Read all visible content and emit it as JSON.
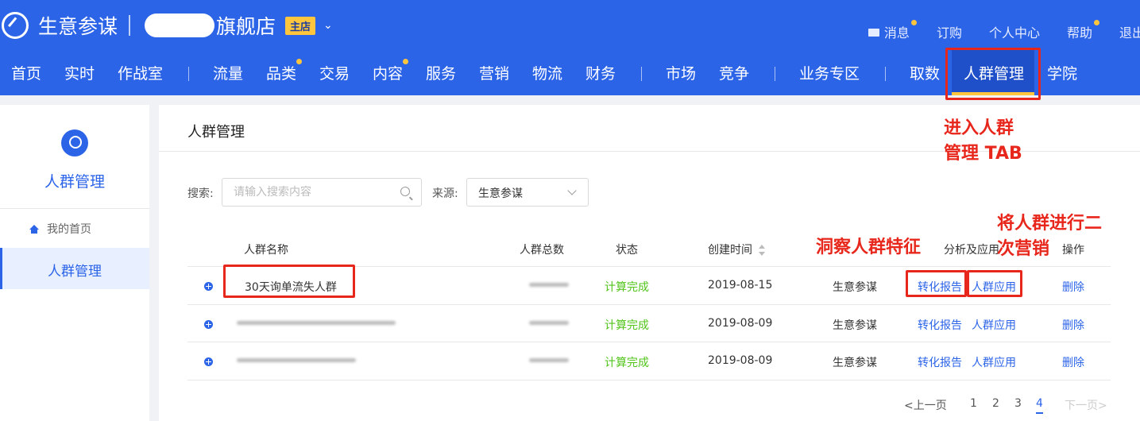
{
  "brand": {
    "name": "生意参谋",
    "shop_suffix": "旗舰店",
    "badge": "主店"
  },
  "top_links": [
    {
      "label": "消息",
      "dot": true
    },
    {
      "label": "订购",
      "dot": false
    },
    {
      "label": "个人中心",
      "dot": false
    },
    {
      "label": "帮助",
      "dot": true
    },
    {
      "label": "退出",
      "dot": false
    }
  ],
  "nav": [
    {
      "label": "首页"
    },
    {
      "label": "实时"
    },
    {
      "label": "作战室"
    },
    {
      "label": "流量"
    },
    {
      "label": "品类",
      "dot": true
    },
    {
      "label": "交易"
    },
    {
      "label": "内容",
      "dot": true
    },
    {
      "label": "服务"
    },
    {
      "label": "营销"
    },
    {
      "label": "物流"
    },
    {
      "label": "财务"
    },
    {
      "label": "市场"
    },
    {
      "label": "竞争"
    },
    {
      "label": "业务专区"
    },
    {
      "label": "取数"
    },
    {
      "label": "人群管理",
      "active": true
    },
    {
      "label": "学院"
    }
  ],
  "sidebar": {
    "title": "人群管理",
    "home": "我的首页",
    "active_item": "人群管理"
  },
  "panel": {
    "title": "人群管理"
  },
  "filters": {
    "search_label": "搜索:",
    "search_placeholder": "请输入搜索内容",
    "source_label": "来源:",
    "source_value": "生意参谋"
  },
  "table": {
    "headers": {
      "name": "人群名称",
      "total": "人群总数",
      "status": "状态",
      "created": "创建时间",
      "analysis": "分析及应用",
      "ops": "操作"
    },
    "rows": [
      {
        "name": "30天询单流失人群",
        "status": "计算完成",
        "date": "2019-08-15",
        "source": "生意参谋",
        "report": "转化报告",
        "apply": "人群应用",
        "delete": "删除"
      },
      {
        "name": "",
        "status": "计算完成",
        "date": "2019-08-09",
        "source": "生意参谋",
        "report": "转化报告",
        "apply": "人群应用",
        "delete": "删除"
      },
      {
        "name": "",
        "status": "计算完成",
        "date": "2019-08-09",
        "source": "生意参谋",
        "report": "转化报告",
        "apply": "人群应用",
        "delete": "删除"
      }
    ]
  },
  "pagination": {
    "prev": "<上一页",
    "pages": [
      "1",
      "2",
      "3",
      "4"
    ],
    "current": "4",
    "next": "下一页>"
  },
  "annotations": {
    "enter_tab": [
      "进入人群",
      "管理 TAB"
    ],
    "insight": "洞察人群特征",
    "remarketing": [
      "将人群进行二",
      "次营销"
    ]
  },
  "colors": {
    "brand_blue": "#2c64e8",
    "accent_yellow": "#ffc53d",
    "annotation_red": "#e8271c",
    "status_green": "#52c41a"
  }
}
